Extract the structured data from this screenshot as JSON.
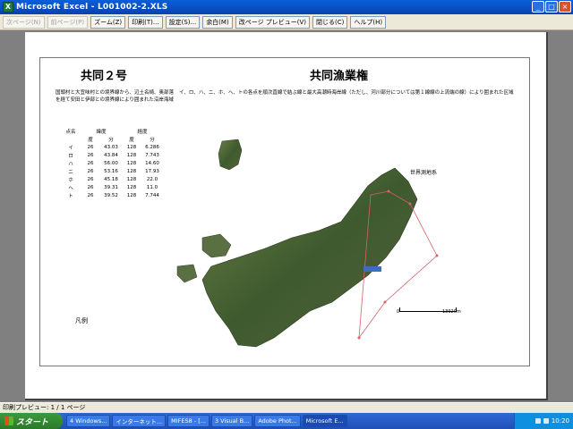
{
  "window": {
    "icon_label": "X",
    "title": "Microsoft Excel - L001002-2.XLS",
    "buttons": [
      "_",
      "□",
      "×"
    ]
  },
  "toolbar": {
    "buttons": [
      {
        "label": "次ページ(N)",
        "enabled": false
      },
      {
        "label": "前ページ(P)",
        "enabled": false
      },
      {
        "label": "ズーム(Z)",
        "enabled": true
      },
      {
        "label": "印刷(T)...",
        "enabled": true
      },
      {
        "label": "設定(S)...",
        "enabled": true
      },
      {
        "label": "余白(M)",
        "enabled": true
      },
      {
        "label": "改ページ プレビュー(V)",
        "enabled": true
      },
      {
        "label": "閉じる(C)",
        "enabled": true
      },
      {
        "label": "ヘルプ(H)",
        "enabled": true
      }
    ]
  },
  "document": {
    "title_left": "共同２号",
    "title_right": "共同漁業権",
    "description_left": "国頭村と大宜味村との境界線から、辺土名崎、奥部落を経て安田と伊部との境界線により囲まれた沿岸海域",
    "description_right": "イ、ロ、ハ、ニ、ホ、ヘ、トの各点を順次直線で結ぶ線と最大高潮時海岸線（ただし、河川部分については第１線線の上流端の線）により囲まれた区域",
    "coordinate_table": {
      "headers": {
        "point": "点名",
        "latitude": "緯度",
        "longitude": "経度",
        "deg": "度",
        "min": "分"
      },
      "rows": [
        [
          "イ",
          "26",
          "43.03",
          "128",
          "6.286"
        ],
        [
          "ロ",
          "26",
          "43.84",
          "128",
          "7.743"
        ],
        [
          "ハ",
          "26",
          "56.00",
          "128",
          "14.60"
        ],
        [
          "ニ",
          "26",
          "53.16",
          "128",
          "17.93"
        ],
        [
          "ホ",
          "26",
          "45.18",
          "128",
          "22.0"
        ],
        [
          "ヘ",
          "26",
          "39.31",
          "128",
          "11.0"
        ],
        [
          "ト",
          "26",
          "39.52",
          "128",
          "7.744"
        ]
      ]
    },
    "legend_label": "凡例",
    "map": {
      "datum_label": "世界測地系",
      "scale_start": "0",
      "scale_end": "13920m",
      "boundary_color": "#d8606a",
      "land_color": "#4f6b3a",
      "water_color": "#ffffff"
    }
  },
  "status": {
    "text": "印刷プレビュー: 1 / 1 ページ"
  },
  "taskbar": {
    "start_label": "スタート",
    "tasks": [
      {
        "label": "4 Windows...",
        "active": false
      },
      {
        "label": "インターネット...",
        "active": false
      },
      {
        "label": "MIFES8 - [...",
        "active": false
      },
      {
        "label": "3 Visual B...",
        "active": false
      },
      {
        "label": "Adobe Phot...",
        "active": false
      },
      {
        "label": "Microsoft E...",
        "active": true
      }
    ],
    "clock": "10:20"
  }
}
